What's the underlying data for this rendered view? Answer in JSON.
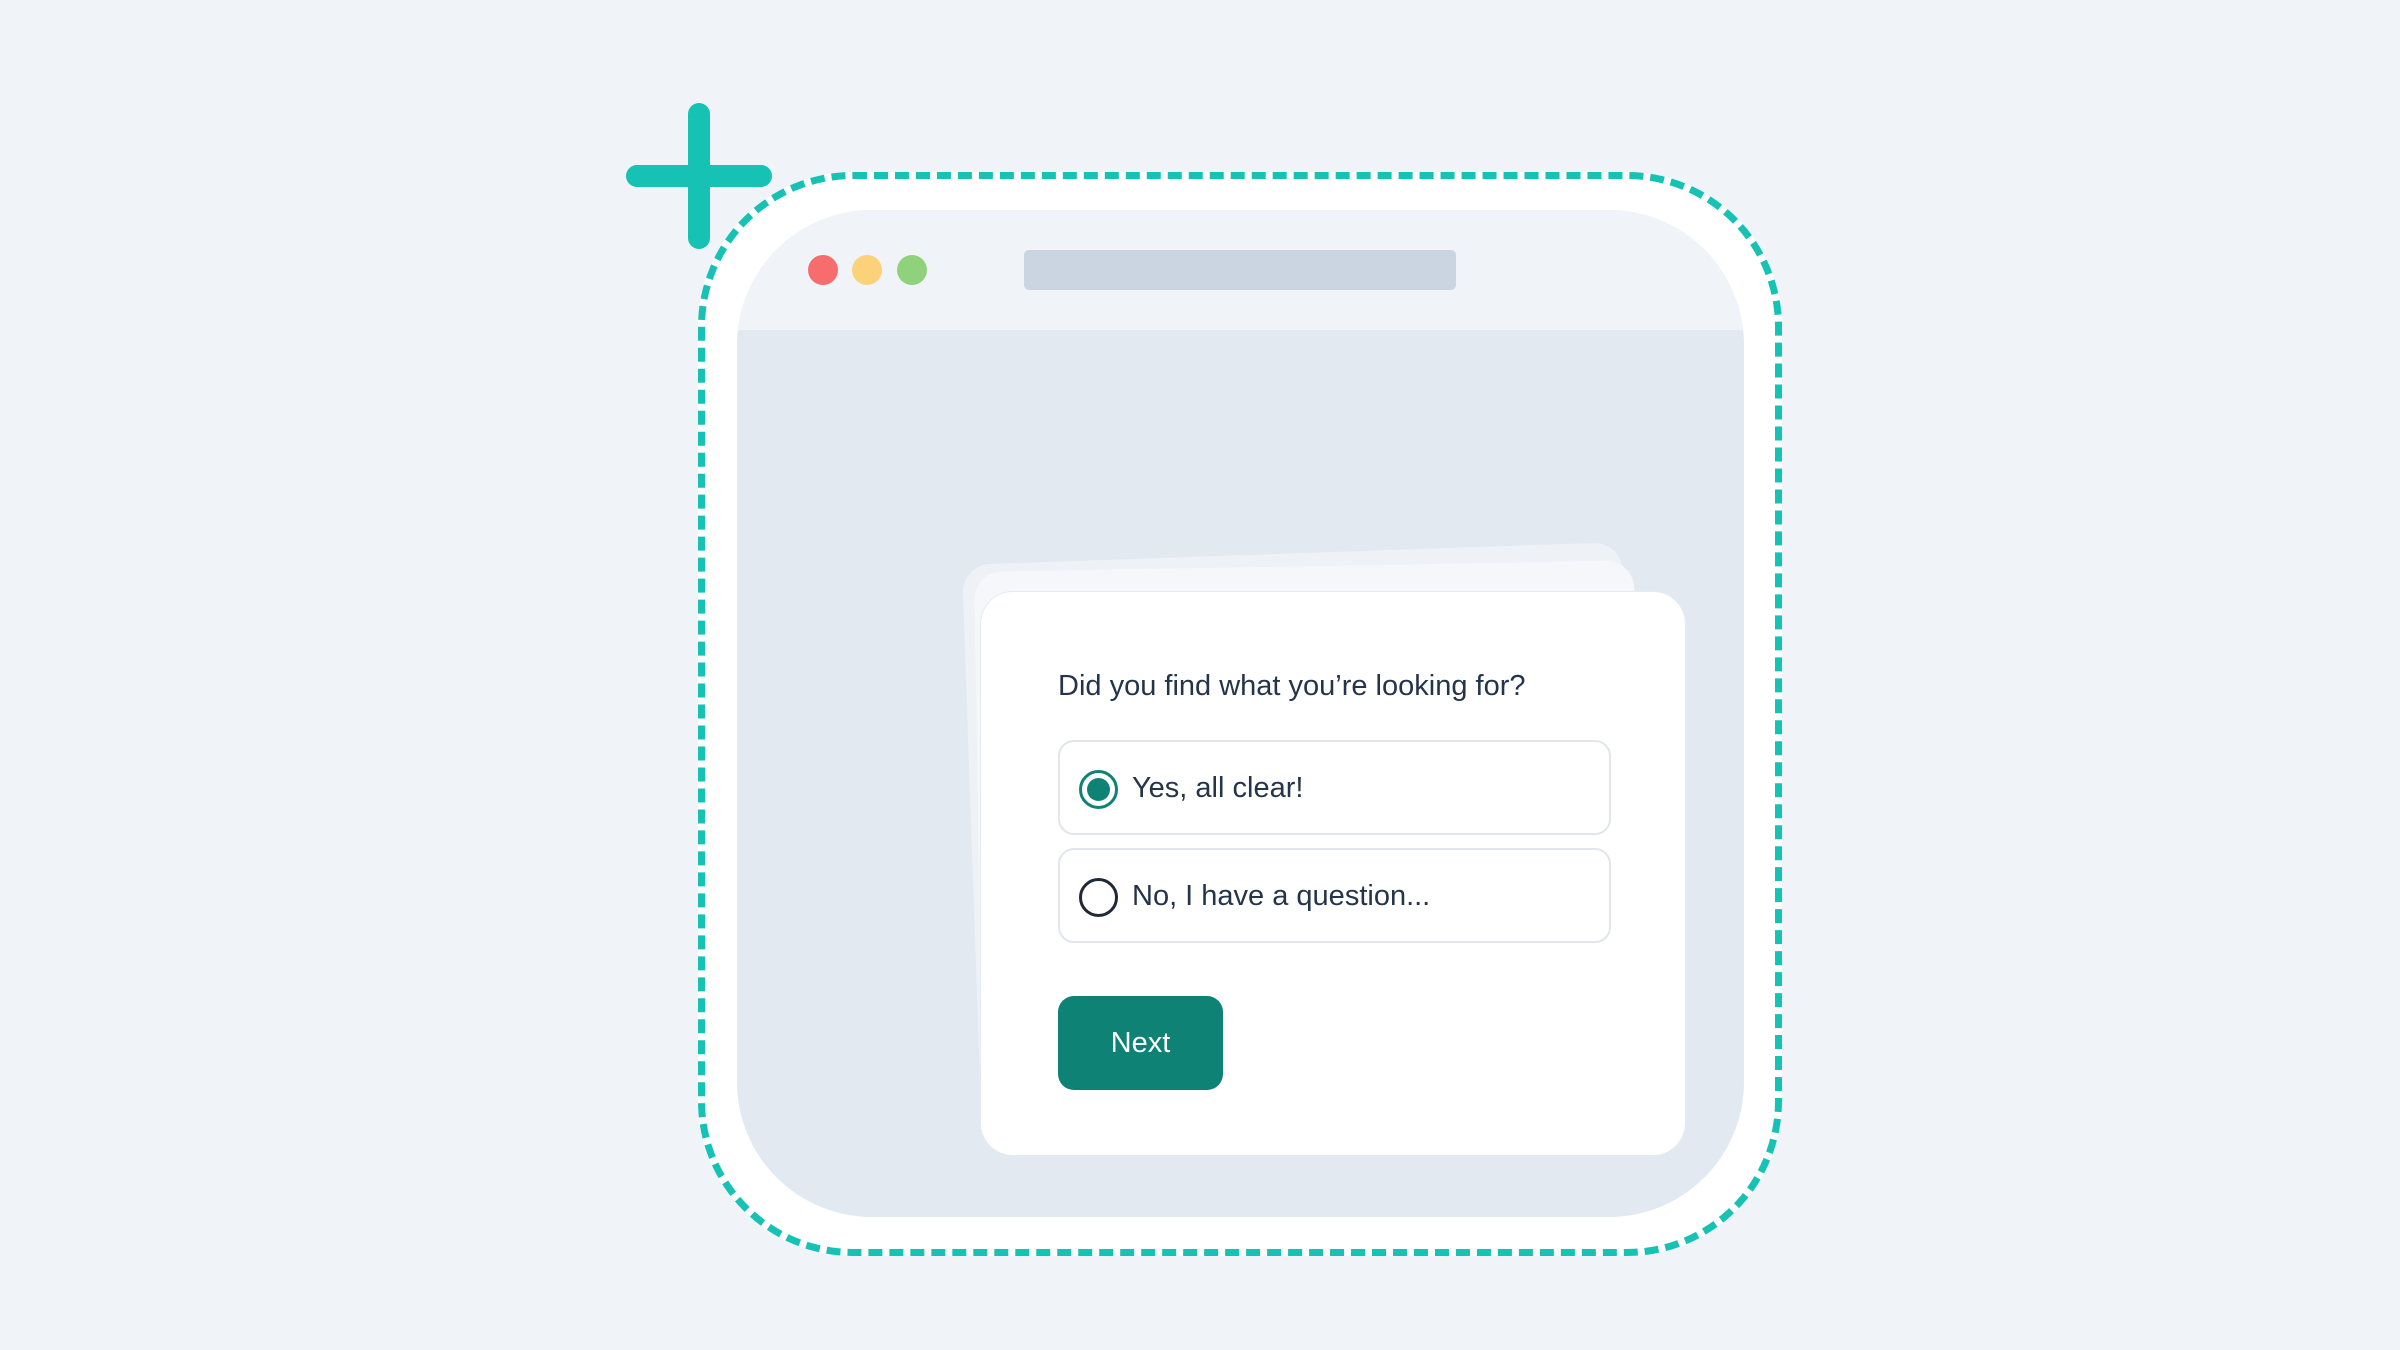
{
  "colors": {
    "page_background": "#f0f4f9",
    "accent_teal": "#16c2b3",
    "primary_button": "#0f8276",
    "window_body": "#e2e9f1",
    "window_titlebar": "#f0f4f9",
    "address_bar": "#cbd5e1",
    "dot_red": "#f76c6c",
    "dot_yellow": "#fbd27a",
    "dot_green": "#8fd27b",
    "text": "#24344a"
  },
  "icons": {
    "corner_marker": "plus-icon",
    "window_controls": [
      "close-dot",
      "minimize-dot",
      "maximize-dot"
    ]
  },
  "survey": {
    "question": "Did you find what you’re looking for?",
    "options": [
      {
        "label": "Yes, all clear!",
        "selected": true
      },
      {
        "label": "No, I have a question...",
        "selected": false
      }
    ],
    "next_label": "Next"
  }
}
